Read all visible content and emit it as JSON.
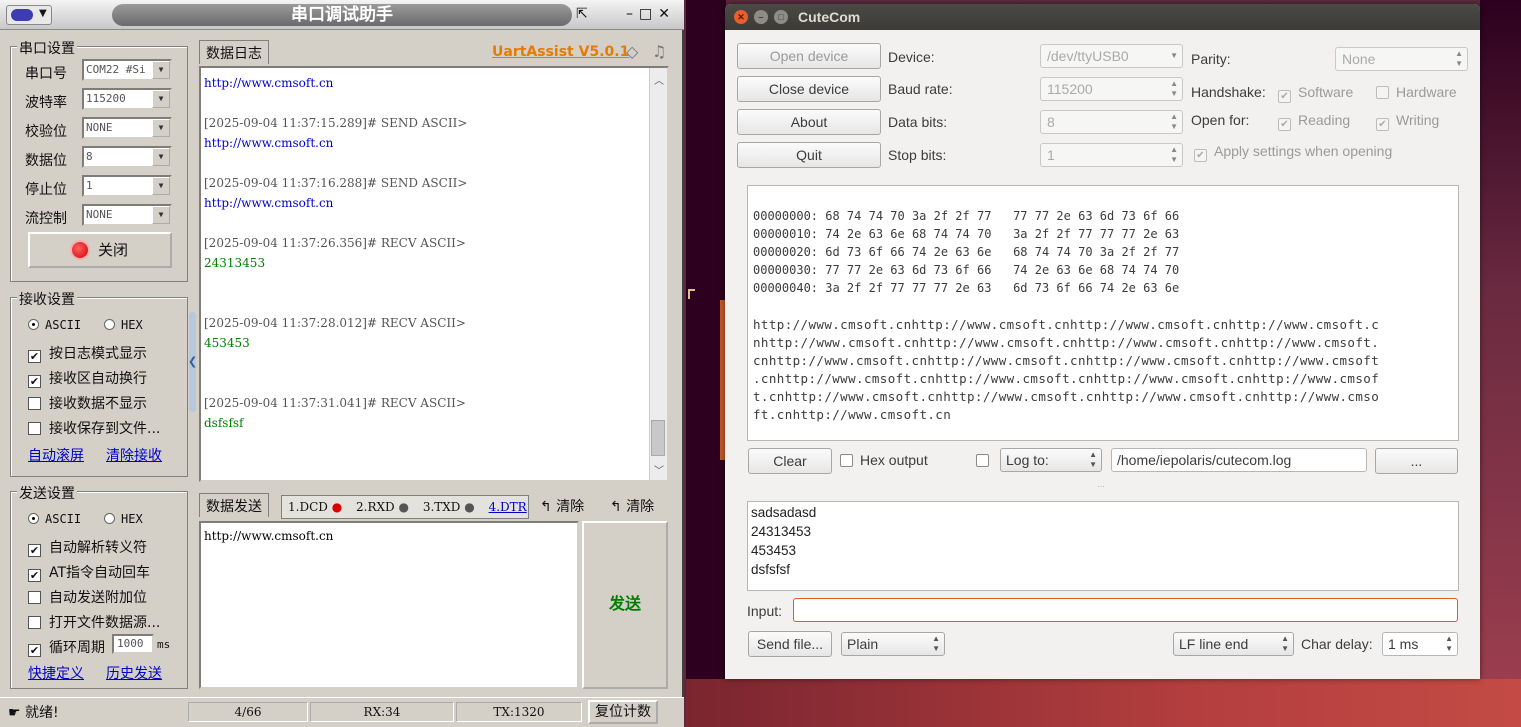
{
  "uart": {
    "title": "串口调试助手",
    "brand": "UartAssist V5.0.1",
    "port_settings": {
      "group": "串口设置",
      "rows": [
        {
          "label": "串口号",
          "value": "COM22 #Si"
        },
        {
          "label": "波特率",
          "value": "115200"
        },
        {
          "label": "校验位",
          "value": "NONE"
        },
        {
          "label": "数据位",
          "value": "8"
        },
        {
          "label": "停止位",
          "value": "1"
        },
        {
          "label": "流控制",
          "value": "NONE"
        }
      ],
      "close_button": "关闭"
    },
    "recv_settings": {
      "group": "接收设置",
      "ascii": "ASCII",
      "hex": "HEX",
      "options": [
        "按日志模式显示",
        "接收区自动换行",
        "接收数据不显示",
        "接收保存到文件..."
      ],
      "auto_scroll": "自动滚屏",
      "clear_recv": "清除接收"
    },
    "send_settings": {
      "group": "发送设置",
      "ascii": "ASCII",
      "hex": "HEX",
      "options": [
        "自动解析转义符",
        "AT指令自动回车",
        "自动发送附加位",
        "打开文件数据源..."
      ],
      "loop": "循环周期",
      "loop_value": "1000",
      "loop_unit": "ms",
      "shortcut": "快捷定义",
      "history": "历史发送"
    },
    "log": {
      "tab": "数据日志",
      "lines": [
        {
          "text": "http://www.cmsoft.cn",
          "kind": "send-data"
        },
        {
          "text": "[2025-09-04 11:37:15.289]# SEND ASCII>",
          "kind": "header"
        },
        {
          "text": "http://www.cmsoft.cn",
          "kind": "send-data"
        },
        {
          "text": "[2025-09-04 11:37:16.288]# SEND ASCII>",
          "kind": "header"
        },
        {
          "text": "http://www.cmsoft.cn",
          "kind": "send-data"
        },
        {
          "text": "[2025-09-04 11:37:26.356]# RECV ASCII>",
          "kind": "header"
        },
        {
          "text": "24313453",
          "kind": "recv-data"
        },
        {
          "text": "[2025-09-04 11:37:28.012]# RECV ASCII>",
          "kind": "header"
        },
        {
          "text": "453453",
          "kind": "recv-data"
        },
        {
          "text": "[2025-09-04 11:37:31.041]# RECV ASCII>",
          "kind": "header"
        },
        {
          "text": "dsfsfsf",
          "kind": "recv-data"
        }
      ]
    },
    "send": {
      "tab": "数据发送",
      "signals": [
        "1.DCD",
        "2.RXD",
        "3.TXD",
        "4.DTR"
      ],
      "clear1": "清除",
      "clear2": "清除",
      "text": "http://www.cmsoft.cn",
      "send_button": "发送"
    },
    "status": {
      "ready": "就绪!",
      "count": "4/66",
      "rx": "RX:34",
      "tx": "TX:1320",
      "reset": "复位计数"
    },
    "colors": {
      "send": "#0000cc",
      "recv": "#008000",
      "brand": "#e87a00"
    }
  },
  "cutecom": {
    "title": "CuteCom",
    "buttons": {
      "open": "Open device",
      "close": "Close device",
      "about": "About",
      "quit": "Quit"
    },
    "device": {
      "label": "Device:",
      "value": "/dev/ttyUSB0"
    },
    "baud": {
      "label": "Baud rate:",
      "value": "115200"
    },
    "databits": {
      "label": "Data bits:",
      "value": "8"
    },
    "stopbits": {
      "label": "Stop bits:",
      "value": "1"
    },
    "parity": {
      "label": "Parity:",
      "value": "None"
    },
    "handshake": {
      "label": "Handshake:",
      "software": "Software",
      "hardware": "Hardware"
    },
    "openfor": {
      "label": "Open for:",
      "reading": "Reading",
      "writing": "Writing"
    },
    "apply": "Apply settings when opening",
    "hex_lines": [
      "00000000: 68 74 74 70 3a 2f 2f 77   77 77 2e 63 6d 73 6f 66",
      "00000010: 74 2e 63 6e 68 74 74 70   3a 2f 2f 77 77 77 2e 63",
      "00000020: 6d 73 6f 66 74 2e 63 6e   68 74 74 70 3a 2f 2f 77",
      "00000030: 77 77 2e 63 6d 73 6f 66   74 2e 63 6e 68 74 74 70",
      "00000040: 3a 2f 2f 77 77 77 2e 63   6d 73 6f 66 74 2e 63 6e"
    ],
    "text_lines": [
      "http://www.cmsoft.cnhttp://www.cmsoft.cnhttp://www.cmsoft.cnhttp://www.cmsoft.c",
      "nhttp://www.cmsoft.cnhttp://www.cmsoft.cnhttp://www.cmsoft.cnhttp://www.cmsoft.",
      "cnhttp://www.cmsoft.cnhttp://www.cmsoft.cnhttp://www.cmsoft.cnhttp://www.cmsoft",
      ".cnhttp://www.cmsoft.cnhttp://www.cmsoft.cnhttp://www.cmsoft.cnhttp://www.cmsof",
      "t.cnhttp://www.cmsoft.cnhttp://www.cmsoft.cnhttp://www.cmsoft.cnhttp://www.cmso",
      "ft.cnhttp://www.cmsoft.cn"
    ],
    "clear": "Clear",
    "hex_output": "Hex output",
    "log_to": "Log to:",
    "log_path": "/home/iepolaris/cutecom.log",
    "browse": "...",
    "history": [
      "sadsadasd",
      "24313453",
      "453453",
      "dsfsfsf"
    ],
    "input_label": "Input:",
    "input_value": "",
    "send_file": "Send file...",
    "mode": "Plain",
    "line_end": "LF line end",
    "char_delay_label": "Char delay:",
    "char_delay": "1 ms"
  }
}
